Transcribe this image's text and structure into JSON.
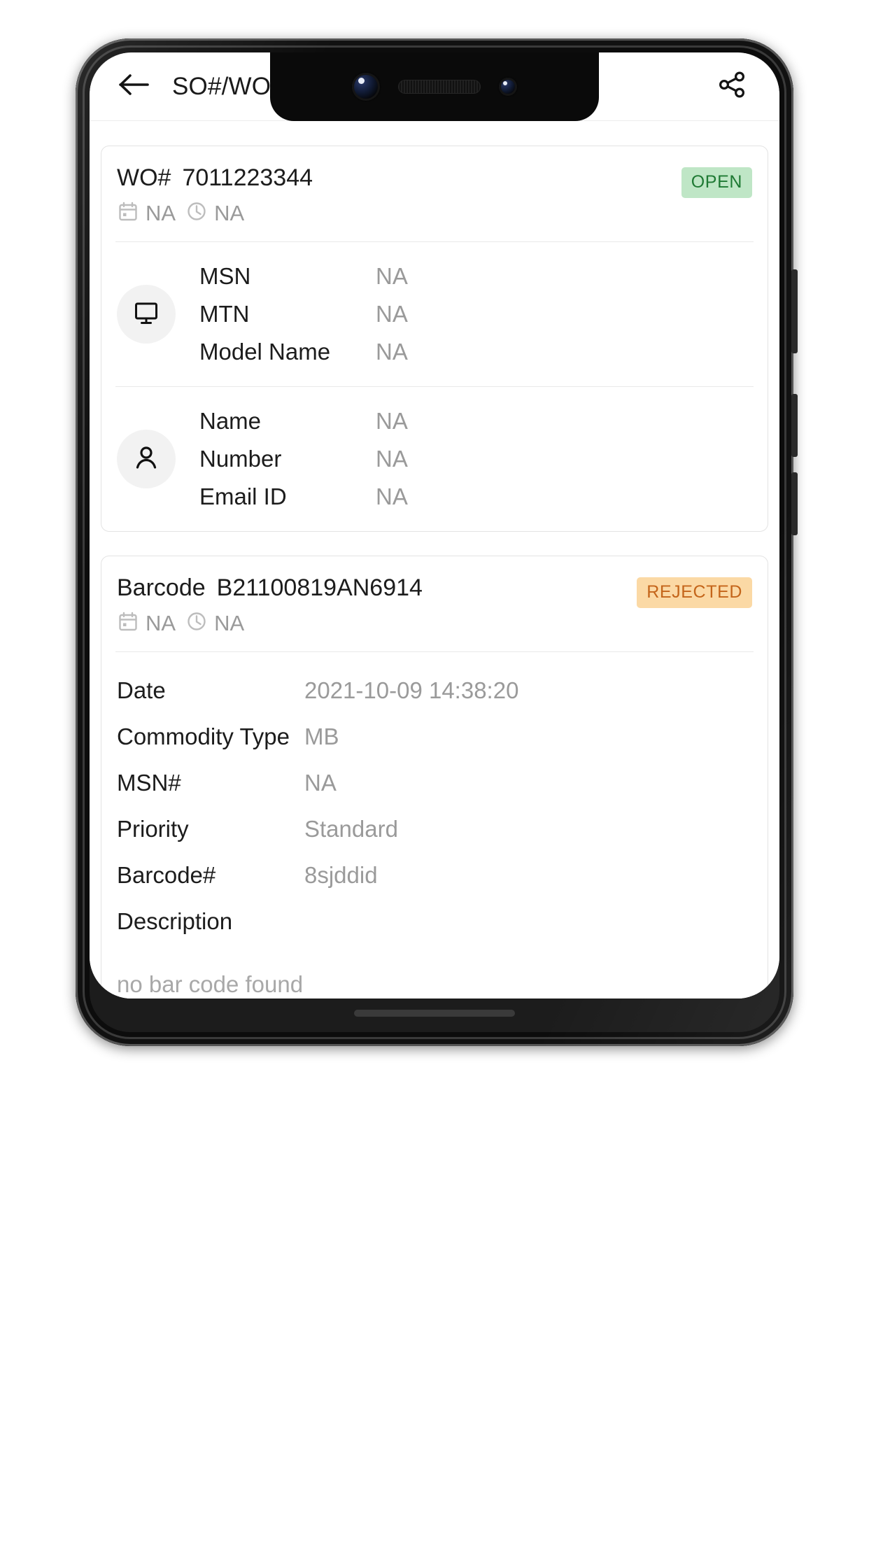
{
  "app_bar": {
    "title": "SO#/WO#",
    "back_icon": "arrow-left-icon",
    "share_icon": "share-icon"
  },
  "wo_card": {
    "title_label": "WO#",
    "title_value": "7011223344",
    "status_badge": {
      "text": "OPEN",
      "bg": "#bfe6c6",
      "fg": "#1f7a34"
    },
    "meta": {
      "date_icon": "calendar-icon",
      "date_text": "NA",
      "time_icon": "clock-icon",
      "time_text": "NA"
    },
    "device_block": {
      "icon": "monitor-icon",
      "rows": [
        {
          "key": "MSN",
          "value": "NA"
        },
        {
          "key": "MTN",
          "value": "NA"
        },
        {
          "key": "Model Name",
          "value": "NA"
        }
      ]
    },
    "contact_block": {
      "icon": "person-icon",
      "rows": [
        {
          "key": "Name",
          "value": "NA"
        },
        {
          "key": "Number",
          "value": "NA"
        },
        {
          "key": "Email ID",
          "value": "NA"
        }
      ]
    }
  },
  "barcode_card": {
    "title_label": "Barcode",
    "title_value": "B21100819AN6914",
    "status_badge": {
      "text": "REJECTED",
      "bg": "#fbd9a5",
      "fg": "#c4651a"
    },
    "meta": {
      "date_icon": "calendar-icon",
      "date_text": "NA",
      "time_icon": "clock-icon",
      "time_text": "NA"
    },
    "details": [
      {
        "key": "Date",
        "value": "2021-10-09 14:38:20"
      },
      {
        "key": "Commodity Type",
        "value": "MB"
      },
      {
        "key": "MSN#",
        "value": "NA"
      },
      {
        "key": "Priority",
        "value": "Standard"
      },
      {
        "key": "Barcode#",
        "value": "8sjddid"
      },
      {
        "key": "Description",
        "value": ""
      }
    ],
    "no_barcode_note": "no bar code found"
  }
}
